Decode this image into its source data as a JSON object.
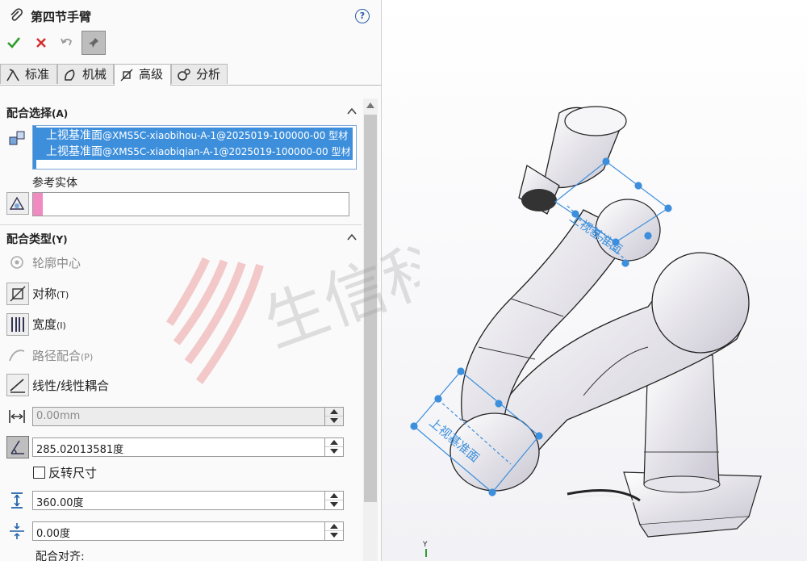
{
  "header": {
    "title": "第四节手臂",
    "help": "?"
  },
  "tabs": [
    {
      "label": "标准",
      "icon": "standard-mate-icon"
    },
    {
      "label": "机械",
      "icon": "mechanical-mate-icon"
    },
    {
      "label": "高级",
      "icon": "advanced-mate-icon"
    },
    {
      "label": "分析",
      "icon": "analysis-icon"
    }
  ],
  "mate_selection": {
    "heading": "配合选择",
    "heading_key": "(A)",
    "items": [
      {
        "name": "上视基准面",
        "ref": "@XMS5C-xiaobihou-A-1@2025019-100000-00 型材"
      },
      {
        "name": "上视基准面",
        "ref": "@XMS5C-xiaobiqian-A-1@2025019-100000-00 型材"
      }
    ],
    "reference_label": "参考实体"
  },
  "mate_types": {
    "heading": "配合类型",
    "heading_key": "(Y)",
    "items": [
      {
        "label": "轮廓中心",
        "key": "",
        "enabled": false
      },
      {
        "label": "对称",
        "key": "(T)",
        "enabled": true
      },
      {
        "label": "宽度",
        "key": "(I)",
        "enabled": true
      },
      {
        "label": "路径配合",
        "key": "(P)",
        "enabled": false
      },
      {
        "label": "线性/线性耦合",
        "key": "",
        "enabled": true
      }
    ]
  },
  "fields": {
    "distance": "0.00mm",
    "angle": "285.02013581度",
    "flip_label": "反转尺寸",
    "upper": "360.00度",
    "lower": "0.00度",
    "align_label": "配合对齐:"
  },
  "watermark": {
    "text": "生信科技"
  },
  "viewport": {
    "plane_label_top": "上视基准面",
    "plane_label_bottom": "上视基准面",
    "axis_y": "Y"
  },
  "colors": {
    "selection": "#3d8fdc",
    "reference_pink": "#f08ac0",
    "accept_green": "#2e9e2e",
    "cancel_red": "#d22a2a",
    "plane_blue": "#3d8fdc"
  }
}
